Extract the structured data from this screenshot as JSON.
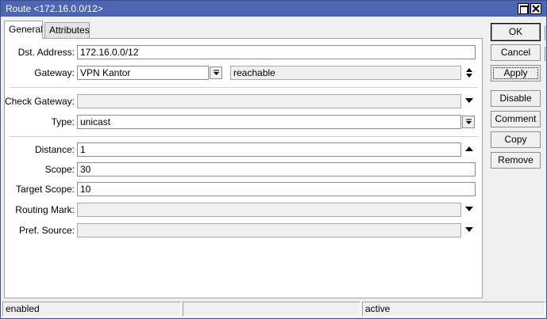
{
  "window": {
    "title": "Route <172.16.0.0/12>"
  },
  "tabs": [
    {
      "label": "General"
    },
    {
      "label": "Attributes"
    }
  ],
  "form": {
    "dst_address": {
      "label": "Dst. Address:",
      "value": "172.16.0.0/12"
    },
    "gateway": {
      "label": "Gateway:",
      "value": "VPN Kantor",
      "state": "reachable"
    },
    "check_gateway": {
      "label": "Check Gateway:",
      "value": ""
    },
    "type": {
      "label": "Type:",
      "value": "unicast"
    },
    "distance": {
      "label": "Distance:",
      "value": "1"
    },
    "scope": {
      "label": "Scope:",
      "value": "30"
    },
    "target_scope": {
      "label": "Target Scope:",
      "value": "10"
    },
    "routing_mark": {
      "label": "Routing Mark:",
      "value": ""
    },
    "pref_source": {
      "label": "Pref. Source:",
      "value": ""
    }
  },
  "buttons": {
    "ok": "OK",
    "cancel": "Cancel",
    "apply": "Apply",
    "disable": "Disable",
    "comment": "Comment",
    "copy": "Copy",
    "remove": "Remove"
  },
  "status": {
    "left": "enabled",
    "middle": "",
    "right": "active"
  },
  "icons": {
    "dropdown": "triangle-down-icon",
    "combo": "list-dropdown-icon",
    "updown": "up-down-arrows-icon",
    "up": "triangle-up-icon"
  },
  "colors": {
    "titlebar": "#4d65b3",
    "title_text": "#ffffff",
    "panel": "#ffffff",
    "window_bg": "#f0f0f0"
  }
}
